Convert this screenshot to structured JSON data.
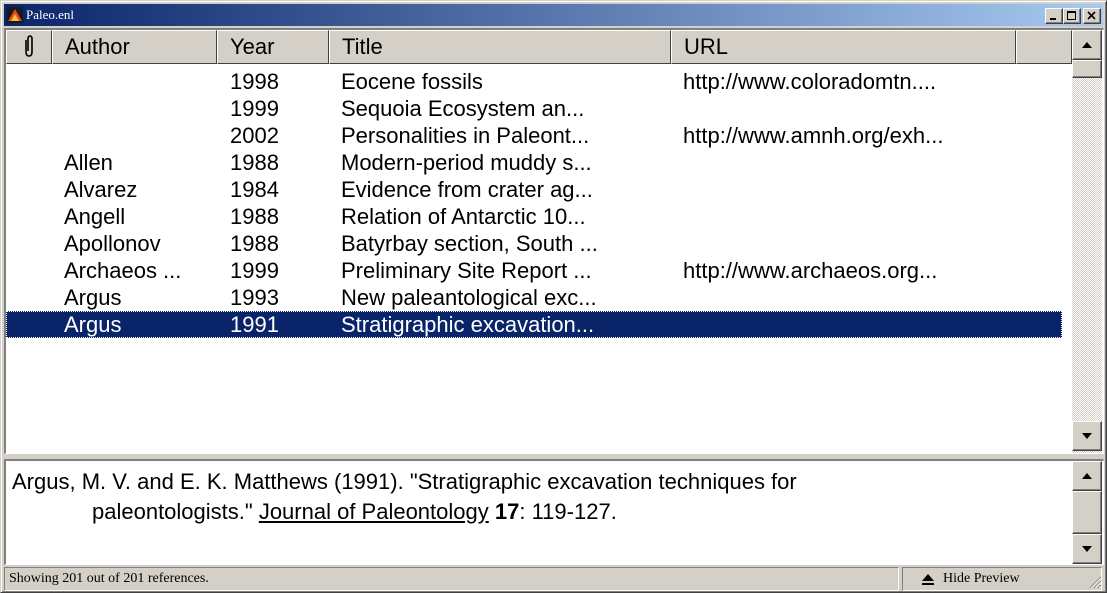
{
  "window": {
    "title": "Paleo.enl"
  },
  "columns": [
    {
      "label": ""
    },
    {
      "label": "Author"
    },
    {
      "label": "Year"
    },
    {
      "label": "Title"
    },
    {
      "label": "URL"
    }
  ],
  "rows": [
    {
      "author": "",
      "year": "1998",
      "title": "Eocene fossils",
      "url": "http://www.coloradomtn...."
    },
    {
      "author": "",
      "year": "1999",
      "title": "Sequoia Ecosystem an...",
      "url": ""
    },
    {
      "author": "",
      "year": "2002",
      "title": "Personalities in Paleont...",
      "url": "http://www.amnh.org/exh..."
    },
    {
      "author": "Allen",
      "year": "1988",
      "title": "Modern-period muddy s...",
      "url": ""
    },
    {
      "author": "Alvarez",
      "year": "1984",
      "title": "Evidence from crater ag...",
      "url": ""
    },
    {
      "author": "Angell",
      "year": "1988",
      "title": "Relation of Antarctic 10...",
      "url": ""
    },
    {
      "author": "Apollonov",
      "year": "1988",
      "title": "Batyrbay section, South ...",
      "url": ""
    },
    {
      "author": "Archaeos ...",
      "year": "1999",
      "title": "Preliminary Site Report ...",
      "url": "http://www.archaeos.org..."
    },
    {
      "author": "Argus",
      "year": "1993",
      "title": "New paleantological exc...",
      "url": ""
    },
    {
      "author": "Argus",
      "year": "1991",
      "title": "Stratigraphic excavation...",
      "url": "",
      "selected": true
    }
  ],
  "preview": {
    "line1": "Argus, M. V. and E. K. Matthews (1991). \"Stratigraphic excavation techniques for",
    "line2_pre": "paleontologists.\" ",
    "journal": "Journal of Paleontology",
    "volume": "17",
    "pages": ": 119-127."
  },
  "status": {
    "text": "Showing 201 out of 201 references.",
    "hide_preview": "Hide Preview"
  },
  "icons": {
    "attachment": "paperclip-icon",
    "app": "endnote-app-icon"
  },
  "colors": {
    "selection": "#0a246a",
    "titlebar_start": "#0a246a",
    "titlebar_end": "#a6caf0"
  }
}
